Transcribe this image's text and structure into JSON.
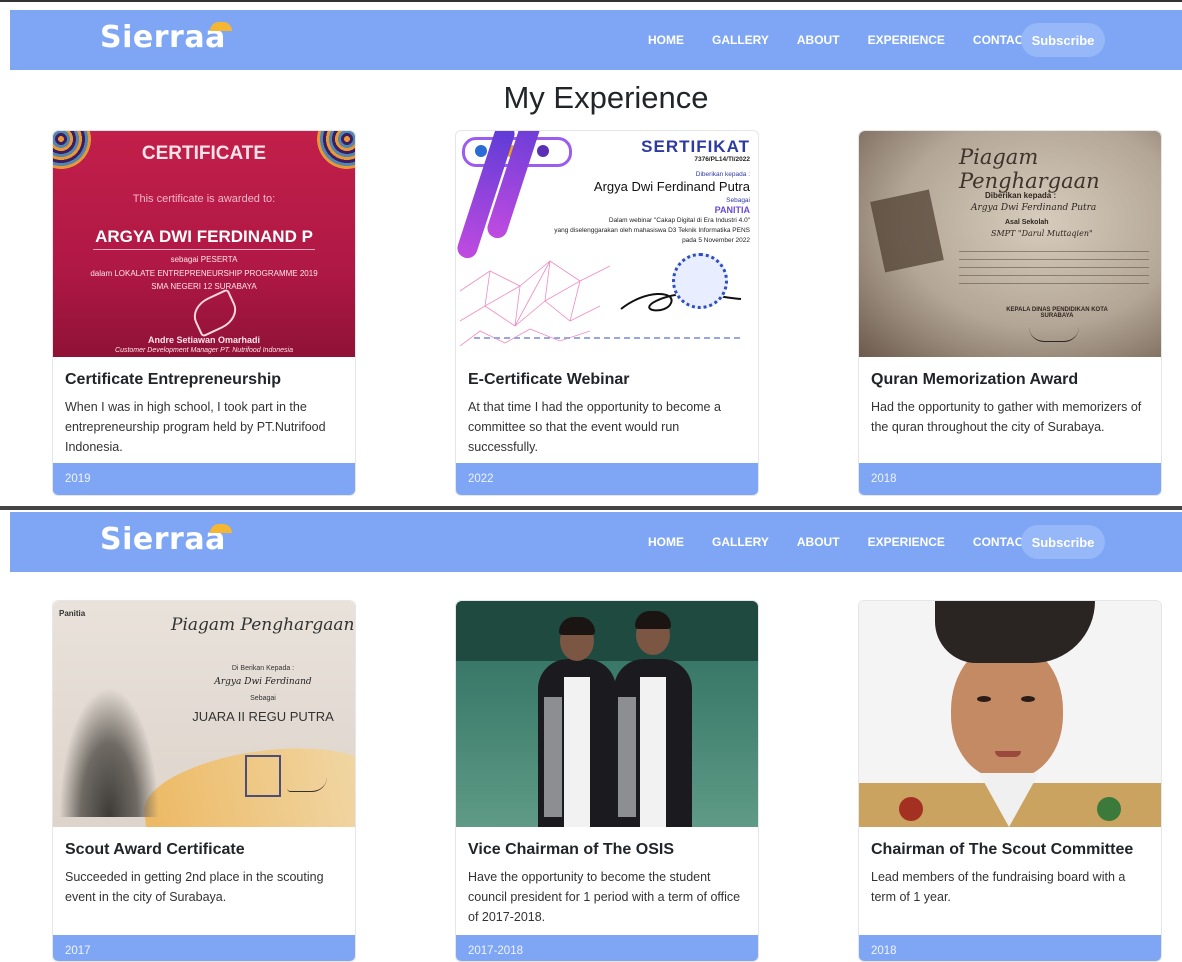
{
  "brand": {
    "name": "Sierraa"
  },
  "nav": {
    "links": [
      "HOME",
      "GALLERY",
      "ABOUT",
      "EXPERIENCE",
      "CONTACT"
    ],
    "subscribe_label": "Subscribe"
  },
  "page": {
    "title": "My Experience"
  },
  "cards": [
    {
      "title": "Certificate Entrepreneurship",
      "text": "When I was in high school, I took part in the entrepreneurship program held by PT.Nutrifood Indonesia.",
      "year": "2019",
      "image": {
        "heading": "CERTIFICATE",
        "sub": "This certificate is awarded to:",
        "name": "ARGYA DWI FERDINAND P",
        "role": "sebagai PESERTA",
        "event": "dalam LOKALATE ENTREPRENEURSHIP PROGRAMME 2019",
        "school": "SMA NEGERI 12 SURABAYA",
        "signer": "Andre Setiawan Omarhadi",
        "signer_title": "Customer Development Manager PT. Nutrifood Indonesia"
      }
    },
    {
      "title": "E-Certificate Webinar",
      "text": "At that time I had the opportunity to become a committee so that the event would run successfully.",
      "year": "2022",
      "image": {
        "heading": "SERTIFIKAT",
        "number": "7376/PL14/TI/2022",
        "given_to": "Diberikan kepada :",
        "name": "Argya Dwi Ferdinand Putra",
        "as": "Sebagai",
        "role": "PANITIA",
        "event": "Dalam webinar \"Cakap Digital di Era Industri 4.0\"",
        "organizer": "yang diselenggarakan oleh mahasiswa D3 Teknik Informatika PENS",
        "date": "pada 5 November 2022"
      }
    },
    {
      "title": "Quran Memorization Award",
      "text": "Had the opportunity to gather with memorizers of the quran throughout the city of Surabaya.",
      "year": "2018",
      "image": {
        "heading": "Piagam Penghargaan",
        "given_to": "Diberikan kepada :",
        "name": "Argya Dwi Ferdinand Putra",
        "school_label": "Asal Sekolah",
        "school": "SMPT \"Darul Muttaqien\"",
        "signer_title": "KEPALA DINAS PENDIDIKAN KOTA SURABAYA"
      }
    },
    {
      "title": "Scout Award Certificate",
      "text": "Succeeded in getting 2nd place in the scouting event in the city of Surabaya.",
      "year": "2017",
      "image": {
        "org": "Panitia",
        "heading": "Piagam Penghargaan",
        "given_to": "Di Berikan Kepada :",
        "name": "Argya Dwi Ferdinand",
        "as": "Sebagai",
        "rank": "JUARA II REGU PUTRA"
      }
    },
    {
      "title": "Vice Chairman of The OSIS",
      "text": "Have the opportunity to become the student council president for 1 period with a term of office of 2017-2018.",
      "year": "2017-2018"
    },
    {
      "title": "Chairman of The Scout Committee",
      "text": "Lead members of the fundraising board with a term of 1 year.",
      "year": "2018"
    }
  ],
  "icons": {
    "brand_accent": "brand-accent-icon",
    "signature": "signature-icon",
    "stamp": "stamp-icon"
  },
  "colors": {
    "navbar": "#7fa6f5",
    "subscribe": "#96b7f8",
    "card_footer": "#7fa6f5",
    "brand_accent": "#f5b731"
  }
}
